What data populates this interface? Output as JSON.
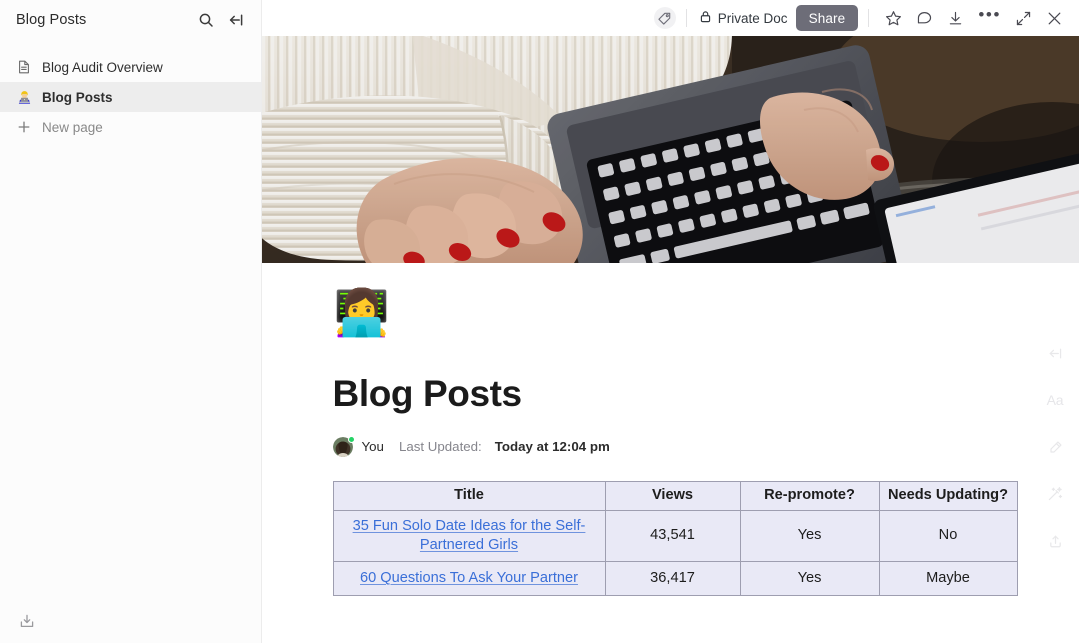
{
  "sidebar": {
    "title": "Blog Posts",
    "search_icon": "search-icon",
    "collapse_icon": "collapse-sidebar-icon",
    "items": [
      {
        "label": "Blog Audit Overview",
        "icon": "document-icon",
        "active": false
      },
      {
        "label": "Blog Posts",
        "icon": "woman-technologist-emoji",
        "active": true
      },
      {
        "label": "New page",
        "icon": "plus-icon",
        "active": false
      }
    ],
    "footer_icon": "import-tray-icon"
  },
  "toolbar": {
    "tag_icon": "tag-icon",
    "privacy_label": "Private Doc",
    "privacy_icon": "lock-icon",
    "share_label": "Share",
    "share_bg": "#6d6d78",
    "icons": [
      {
        "name": "favorite-star-icon",
        "glyph": "star"
      },
      {
        "name": "comment-icon",
        "glyph": "comment"
      },
      {
        "name": "download-icon",
        "glyph": "download"
      },
      {
        "name": "more-options-icon",
        "glyph": "dots"
      },
      {
        "name": "expand-icon",
        "glyph": "expand"
      },
      {
        "name": "close-icon",
        "glyph": "close"
      }
    ]
  },
  "hero": {
    "alt": "Woman in cream knit sweater typing on a laptop with red nail polish",
    "colors": {
      "sweater": "#efe9e0",
      "laptop": "#51535a",
      "keys": "#121214",
      "skin": "#d8aa91",
      "nails": "#c21a1a",
      "background": "#3a2f27"
    }
  },
  "document": {
    "emoji": "👩‍💻",
    "emoji_name": "woman-technologist-emoji",
    "title": "Blog Posts",
    "meta": {
      "author": "You",
      "updated_label": "Last Updated:",
      "updated_value": "Today at 12:04 pm",
      "presence_color": "#25d366"
    },
    "table": {
      "headers": [
        "Title",
        "Views",
        "Re-promote?",
        "Needs Updating?"
      ],
      "rows": [
        {
          "title": "35 Fun Solo Date Ideas for the Self-Partnered Girls",
          "views": "43,541",
          "repromote": "Yes",
          "needs_updating": "No"
        },
        {
          "title": "60 Questions To Ask Your Partner ",
          "views": "36,417",
          "repromote": "Yes",
          "needs_updating": "Maybe"
        }
      ],
      "header_bg": "#e9e9f6",
      "link_color": "#3a6fd8",
      "border_color": "#9e9eb0"
    }
  },
  "right_rail": [
    {
      "name": "return-icon",
      "glyph": "return"
    },
    {
      "name": "text-format-icon",
      "glyph": "Aa"
    },
    {
      "name": "highlighter-icon",
      "glyph": "highlighter"
    },
    {
      "name": "magic-wand-icon",
      "glyph": "wand"
    },
    {
      "name": "share-upload-icon",
      "glyph": "upload"
    }
  ]
}
